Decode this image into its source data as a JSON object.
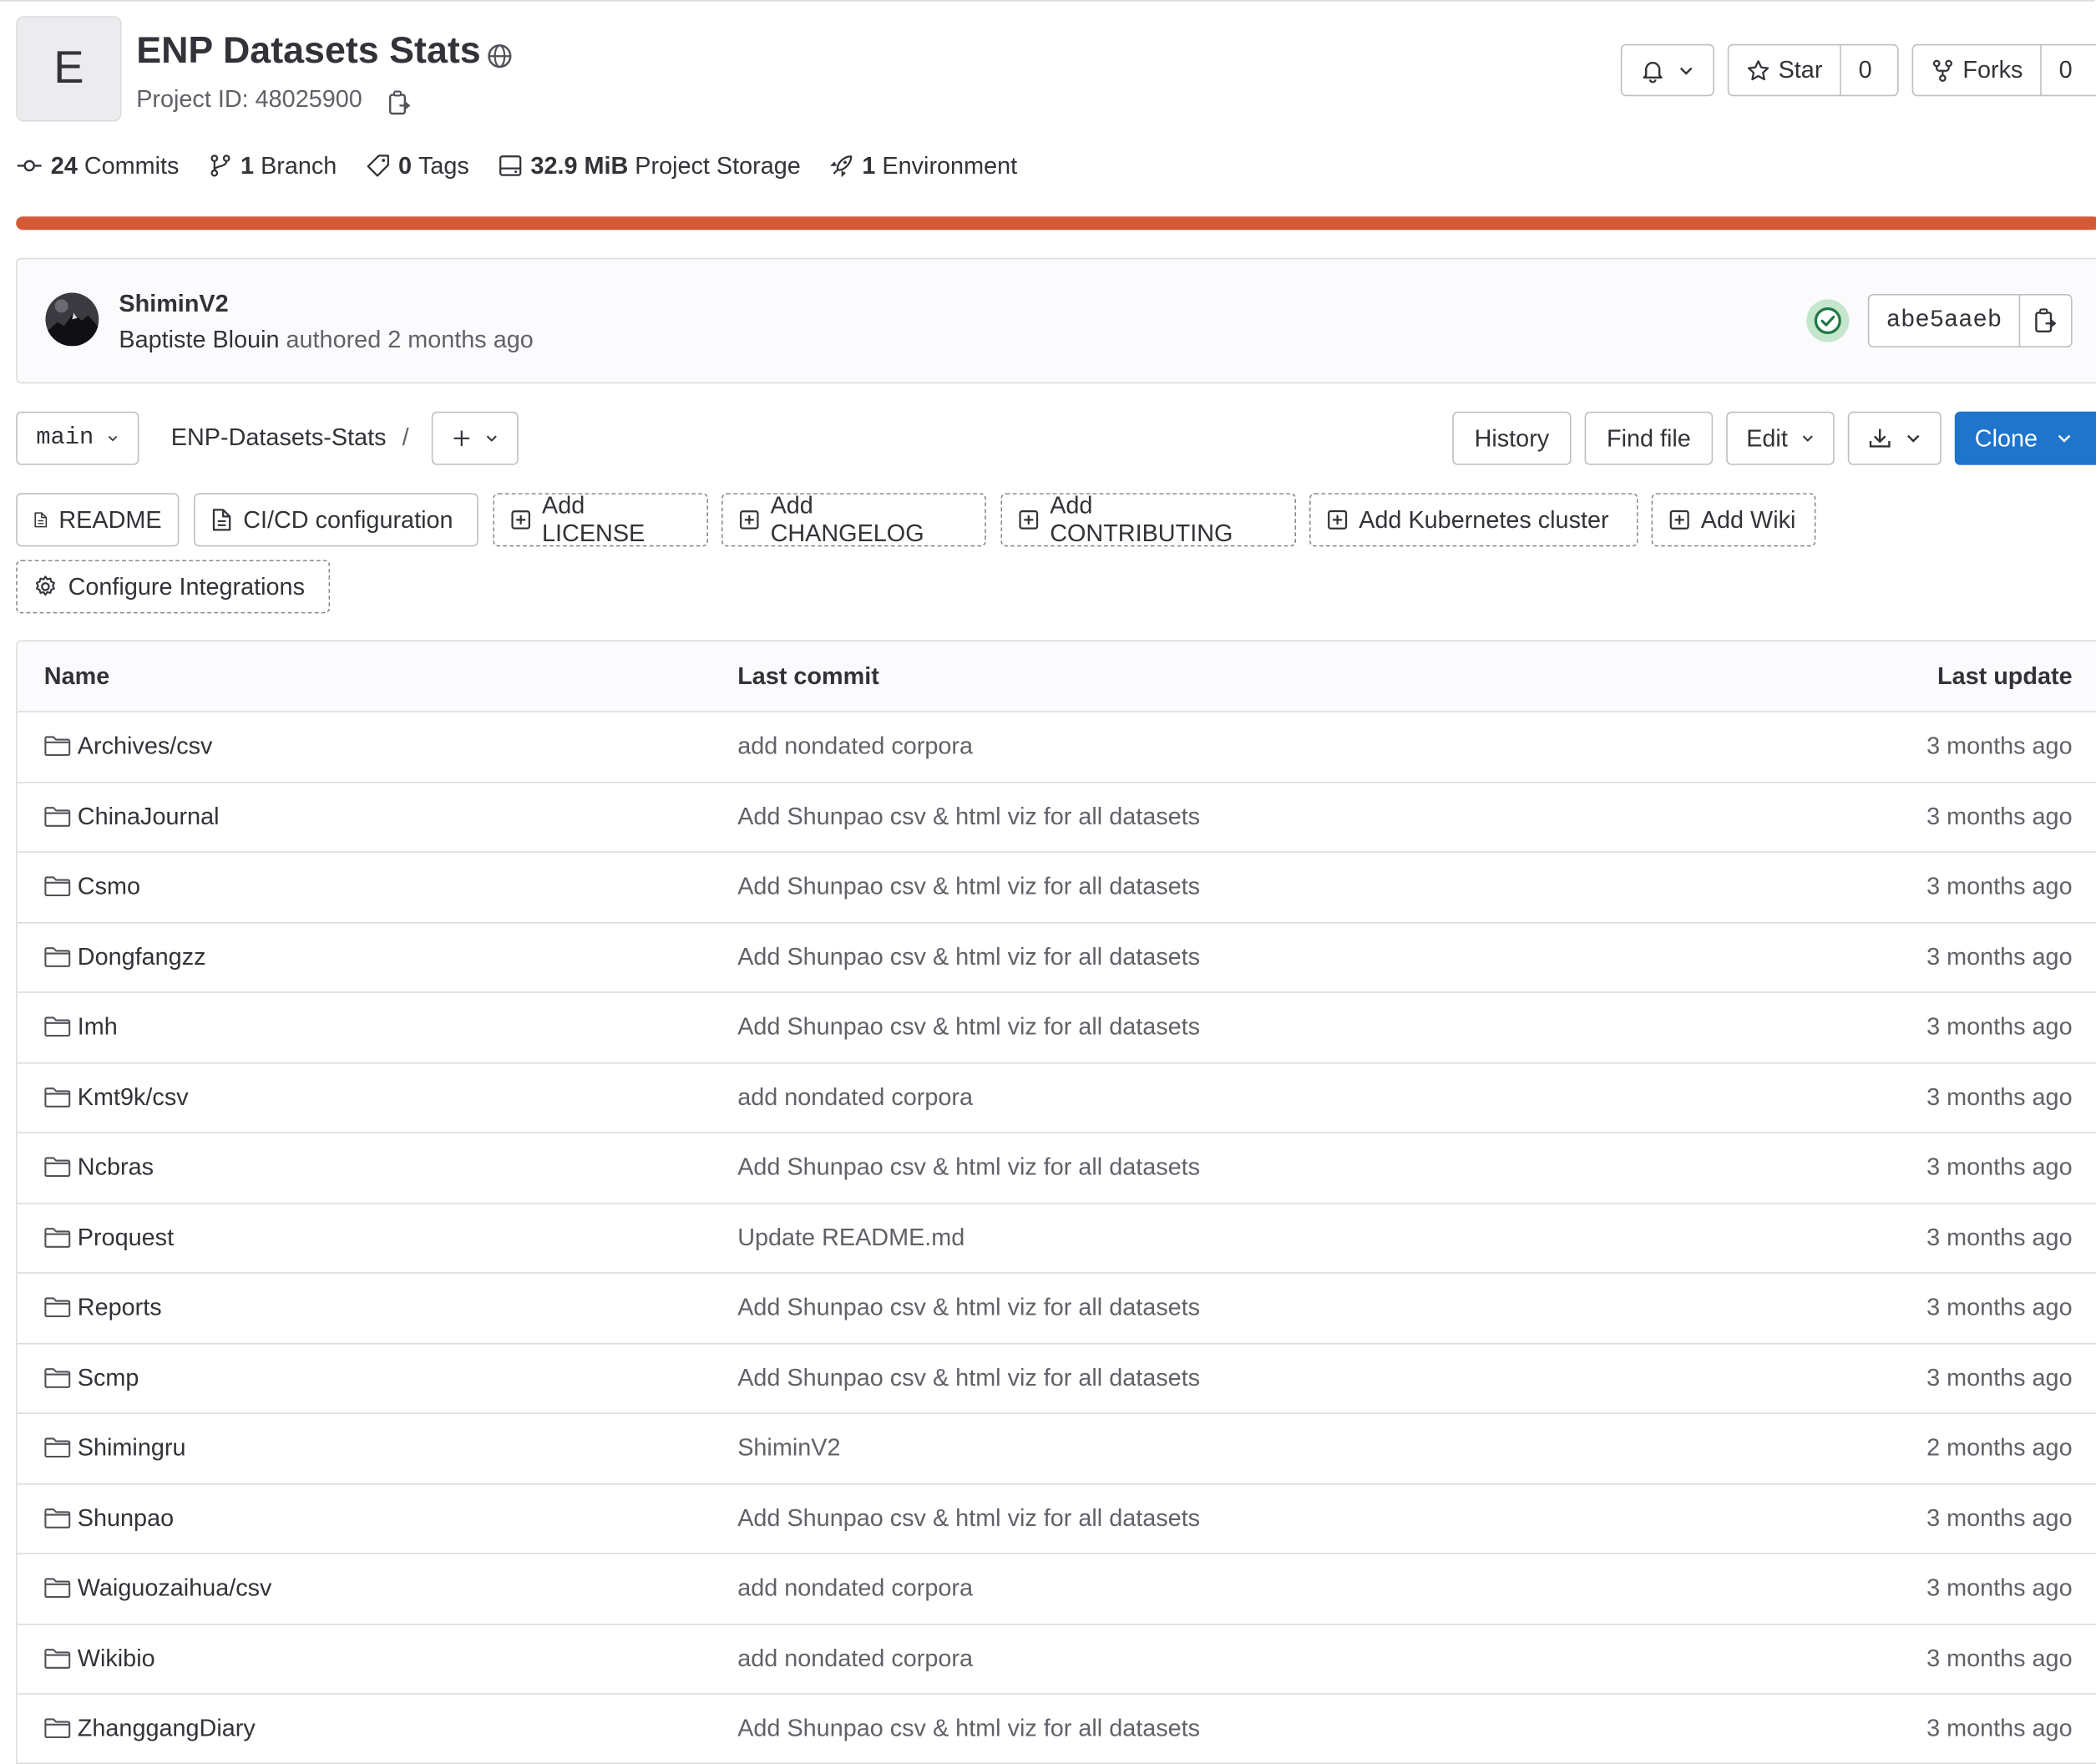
{
  "project": {
    "avatar_letter": "E",
    "title": "ENP Datasets Stats",
    "id_label": "Project ID: 48025900"
  },
  "header_actions": {
    "star_label": "Star",
    "star_count": "0",
    "forks_label": "Forks",
    "forks_count": "0"
  },
  "stats": {
    "commits_count": "24",
    "commits_label": "Commits",
    "branch_count": "1",
    "branch_label": "Branch",
    "tags_count": "0",
    "tags_label": "Tags",
    "storage_size": "32.9 MiB",
    "storage_label": "Project Storage",
    "env_count": "1",
    "env_label": "Environment"
  },
  "language_bar_color": "#d45a36",
  "last_commit": {
    "title": "ShiminV2",
    "author": "Baptiste Blouin",
    "meta": " authored 2 months ago",
    "sha": "abe5aaeb"
  },
  "toolbar": {
    "branch": "main",
    "path": "ENP-Datasets-Stats",
    "path_sep": "/",
    "history": "History",
    "find_file": "Find file",
    "edit": "Edit",
    "clone": "Clone"
  },
  "quick_actions": {
    "readme": "README",
    "cicd": "CI/CD configuration",
    "license": "Add LICENSE",
    "changelog": "Add CHANGELOG",
    "contributing": "Add CONTRIBUTING",
    "kubernetes": "Add Kubernetes cluster",
    "wiki": "Add Wiki",
    "integrations": "Configure Integrations"
  },
  "table": {
    "headers": {
      "name": "Name",
      "commit": "Last commit",
      "update": "Last update"
    },
    "rows": [
      {
        "name": "Archives/csv",
        "commit": "add nondated corpora",
        "updated": "3 months ago"
      },
      {
        "name": "ChinaJournal",
        "commit": "Add Shunpao csv & html viz for all datasets",
        "updated": "3 months ago"
      },
      {
        "name": "Csmo",
        "commit": "Add Shunpao csv & html viz for all datasets",
        "updated": "3 months ago"
      },
      {
        "name": "Dongfangzz",
        "commit": "Add Shunpao csv & html viz for all datasets",
        "updated": "3 months ago"
      },
      {
        "name": "Imh",
        "commit": "Add Shunpao csv & html viz for all datasets",
        "updated": "3 months ago"
      },
      {
        "name": "Kmt9k/csv",
        "commit": "add nondated corpora",
        "updated": "3 months ago"
      },
      {
        "name": "Ncbras",
        "commit": "Add Shunpao csv & html viz for all datasets",
        "updated": "3 months ago"
      },
      {
        "name": "Proquest",
        "commit": "Update README.md",
        "updated": "3 months ago"
      },
      {
        "name": "Reports",
        "commit": "Add Shunpao csv & html viz for all datasets",
        "updated": "3 months ago"
      },
      {
        "name": "Scmp",
        "commit": "Add Shunpao csv & html viz for all datasets",
        "updated": "3 months ago"
      },
      {
        "name": "Shimingru",
        "commit": "ShiminV2",
        "updated": "2 months ago"
      },
      {
        "name": "Shunpao",
        "commit": "Add Shunpao csv & html viz for all datasets",
        "updated": "3 months ago"
      },
      {
        "name": "Waiguozaihua/csv",
        "commit": "add nondated corpora",
        "updated": "3 months ago"
      },
      {
        "name": "Wikibio",
        "commit": "add nondated corpora",
        "updated": "3 months ago"
      },
      {
        "name": "ZhanggangDiary",
        "commit": "Add Shunpao csv & html viz for all datasets",
        "updated": "3 months ago"
      }
    ]
  },
  "icons": {
    "globe": "globe-icon",
    "copy": "copy-icon",
    "bell": "bell-icon",
    "star": "star-icon",
    "fork": "fork-icon",
    "commit": "commit-icon",
    "branch": "branch-icon",
    "tag": "tag-icon",
    "storage": "storage-icon",
    "rocket": "rocket-icon",
    "check": "status-success-icon",
    "plus": "plus-icon",
    "download": "download-icon",
    "doc": "document-icon",
    "plus-square": "plus-square-icon",
    "gear": "gear-icon",
    "folder": "folder-icon"
  }
}
